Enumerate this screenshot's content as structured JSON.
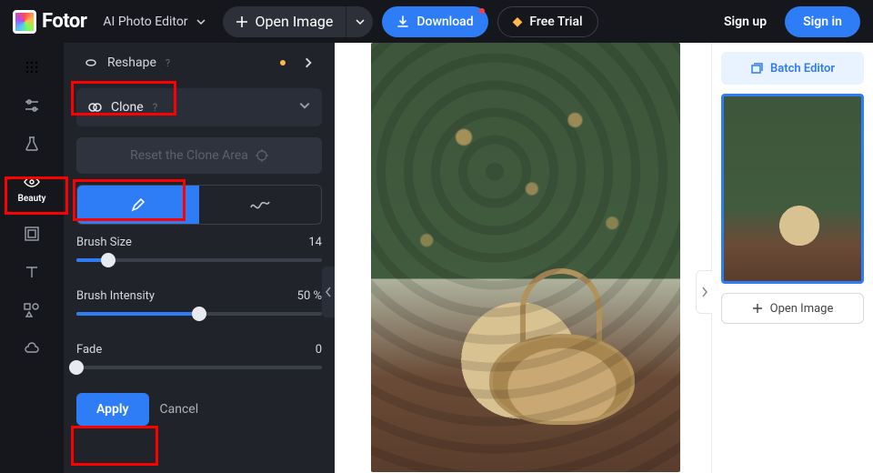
{
  "brand": "Fotor",
  "topbar": {
    "mode": "AI Photo Editor",
    "open_image": "Open Image",
    "download": "Download",
    "free_trial": "Free Trial",
    "signup": "Sign up",
    "signin": "Sign in"
  },
  "rail": {
    "beauty": "Beauty"
  },
  "panel": {
    "reshape": "Reshape",
    "clone": "Clone",
    "reset": "Reset the Clone Area",
    "brush_size_label": "Brush Size",
    "brush_size_value": "14",
    "brush_intensity_label": "Brush Intensity",
    "brush_intensity_value": "50 %",
    "fade_label": "Fade",
    "fade_value": "0",
    "apply": "Apply",
    "cancel": "Cancel"
  },
  "right": {
    "batch": "Batch Editor",
    "open": "Open Image"
  },
  "sliders": {
    "brush_size_pct": 13,
    "brush_intensity_pct": 50,
    "fade_pct": 0
  }
}
